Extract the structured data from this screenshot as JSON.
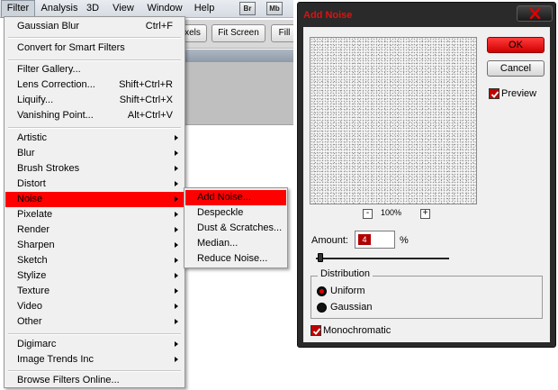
{
  "menubar": {
    "items": [
      "Filter",
      "Analysis",
      "3D",
      "View",
      "Window",
      "Help"
    ],
    "badges": [
      "Br",
      "Mb"
    ]
  },
  "toolbar": {
    "buttons": [
      "xels",
      "Fit Screen",
      "Fill"
    ]
  },
  "filter_menu": {
    "sections": [
      [
        {
          "label": "Gaussian Blur",
          "shortcut": "Ctrl+F"
        }
      ],
      [
        {
          "label": "Convert for Smart Filters"
        }
      ],
      [
        {
          "label": "Filter Gallery..."
        },
        {
          "label": "Lens Correction...",
          "shortcut": "Shift+Ctrl+R"
        },
        {
          "label": "Liquify...",
          "shortcut": "Shift+Ctrl+X"
        },
        {
          "label": "Vanishing Point...",
          "shortcut": "Alt+Ctrl+V"
        }
      ],
      [
        {
          "label": "Artistic",
          "submenu": true
        },
        {
          "label": "Blur",
          "submenu": true
        },
        {
          "label": "Brush Strokes",
          "submenu": true
        },
        {
          "label": "Distort",
          "submenu": true
        },
        {
          "label": "Noise",
          "submenu": true,
          "highlighted": true
        },
        {
          "label": "Pixelate",
          "submenu": true
        },
        {
          "label": "Render",
          "submenu": true
        },
        {
          "label": "Sharpen",
          "submenu": true
        },
        {
          "label": "Sketch",
          "submenu": true
        },
        {
          "label": "Stylize",
          "submenu": true
        },
        {
          "label": "Texture",
          "submenu": true
        },
        {
          "label": "Video",
          "submenu": true
        },
        {
          "label": "Other",
          "submenu": true
        }
      ],
      [
        {
          "label": "Digimarc",
          "submenu": true
        },
        {
          "label": "Image Trends Inc",
          "submenu": true
        }
      ],
      [
        {
          "label": "Browse Filters Online..."
        }
      ]
    ]
  },
  "noise_submenu": {
    "items": [
      {
        "label": "Add Noise...",
        "highlighted": true
      },
      {
        "label": "Despeckle"
      },
      {
        "label": "Dust & Scratches..."
      },
      {
        "label": "Median..."
      },
      {
        "label": "Reduce Noise..."
      }
    ]
  },
  "dialog": {
    "title": "Add Noise",
    "ok_label": "OK",
    "cancel_label": "Cancel",
    "preview_label": "Preview",
    "preview_checked": true,
    "zoom_out": "-",
    "zoom_level": "100%",
    "zoom_in": "+",
    "amount_label": "Amount:",
    "amount_value": "4",
    "amount_unit": "%",
    "distribution_label": "Distribution",
    "uniform_label": "Uniform",
    "gaussian_label": "Gaussian",
    "distribution_selected": "Uniform",
    "monochromatic_label": "Monochromatic",
    "monochromatic_checked": true
  },
  "colors": {
    "highlight": "#ff0000",
    "dialog_frame": "#2a2a2a",
    "title_text": "#e01010"
  }
}
